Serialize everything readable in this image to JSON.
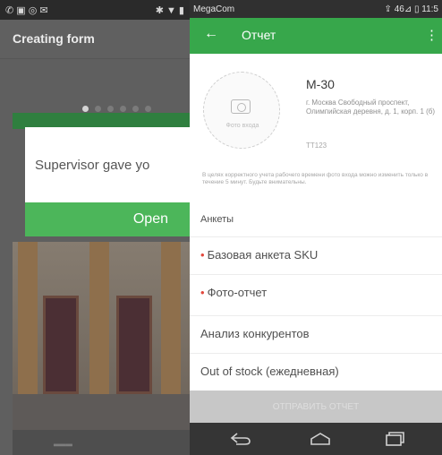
{
  "left_screen": {
    "status_icons": "✆ ▣ ◎ ✉",
    "status_right": "✱ ▼ ▮",
    "title": "Creating form",
    "dots_total": 6,
    "dots_active_index": 0,
    "dialog": {
      "message": "Supervisor gave yo",
      "button_label": "Open"
    },
    "bottom_text": "▂▂▂"
  },
  "right_screen": {
    "carrier": "MegaCom",
    "status_right": "⇪ 46⊿ ▯ 11:5",
    "app_title": "Отчет",
    "photo_caption": "Фото входа",
    "store_name": "М-30",
    "store_address": "г. Москва Свободный проспект, Олимпийская деревня, д. 1, корп. 1 (б)",
    "store_code": "ТТ123",
    "note": "В целях корректного учета рабочего времени фото входа можно изменить только в течение 5 минут. Будьте внимательны.",
    "section_title": "Анкеты",
    "forms": [
      {
        "label": "Базовая анкета SKU",
        "required": true
      },
      {
        "label": "Фото-отчет",
        "required": true
      },
      {
        "label": "Анализ конкурентов",
        "required": false
      },
      {
        "label": "Out of stock (ежедневная)",
        "required": false
      }
    ],
    "send_button_label": "ОТПРАВИТЬ ОТЧЕТ"
  },
  "colors": {
    "accent_green": "#37a74b",
    "dialog_button_green": "#4cb65a",
    "required_bullet_red": "#e2483d"
  }
}
